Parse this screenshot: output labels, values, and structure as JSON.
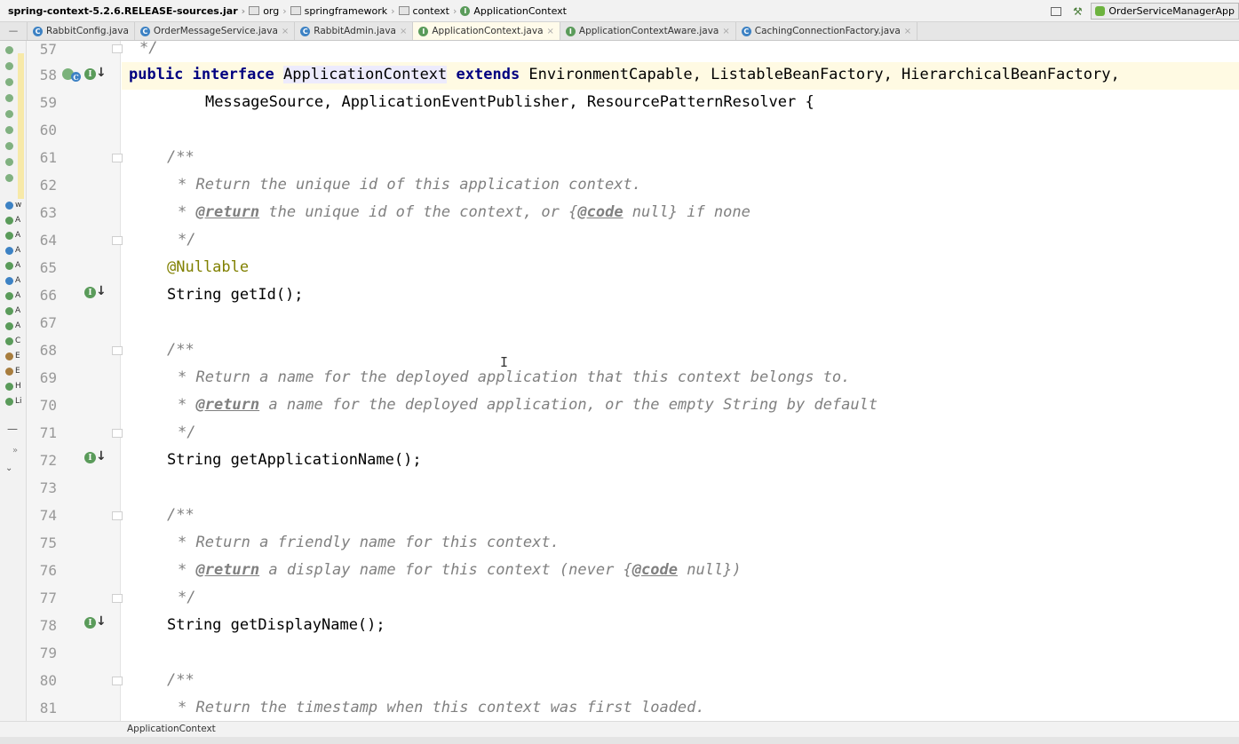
{
  "breadcrumb": {
    "jar": "spring-context-5.2.6.RELEASE-sources.jar",
    "segments": [
      "org",
      "springframework",
      "context"
    ],
    "current": "ApplicationContext"
  },
  "run_config": "OrderServiceManagerApp",
  "tabs": [
    {
      "label": "RabbitConfig.java",
      "type": "class"
    },
    {
      "label": "OrderMessageService.java",
      "type": "class"
    },
    {
      "label": "RabbitAdmin.java",
      "type": "class"
    },
    {
      "label": "ApplicationContext.java",
      "type": "interface",
      "active": true
    },
    {
      "label": "ApplicationContextAware.java",
      "type": "interface"
    },
    {
      "label": "CachingConnectionFactory.java",
      "type": "class"
    }
  ],
  "structure_items": [
    "w",
    "A",
    "A",
    "A",
    "A",
    "A",
    "A",
    "A",
    "A",
    "C",
    "E",
    "E",
    "H",
    "Li"
  ],
  "line_numbers": [
    "57",
    "58",
    "59",
    "60",
    "61",
    "62",
    "63",
    "64",
    "65",
    "66",
    "67",
    "68",
    "69",
    "70",
    "71",
    "72",
    "73",
    "74",
    "75",
    "76",
    "77",
    "78",
    "79",
    "80",
    "81"
  ],
  "code": {
    "l57": "*/",
    "l58": {
      "public": "public",
      "interface": "interface",
      "name": "ApplicationContext",
      "extends": "extends",
      "rest": " EnvironmentCapable, ListableBeanFactory, HierarchicalBeanFactory,"
    },
    "l59": "MessageSource, ApplicationEventPublisher, ResourcePatternResolver {",
    "l61": "/**",
    "l62": "* Return the unique id of this application context.",
    "l63": {
      "star": "* ",
      "tag": "@return",
      "text": " the unique id of the context, or {",
      "code_tag": "@code",
      "tail": " null} if none"
    },
    "l64": "*/",
    "l65": "@Nullable",
    "l66": "String getId();",
    "l68": "/**",
    "l69": "* Return a name for the deployed application that this context belongs to.",
    "l70": {
      "star": "* ",
      "tag": "@return",
      "text": " a name for the deployed application, or the empty String by default"
    },
    "l71": "*/",
    "l72": "String getApplicationName();",
    "l74": "/**",
    "l75": "* Return a friendly name for this context.",
    "l76": {
      "star": "* ",
      "tag": "@return",
      "text": " a display name for this context (never {",
      "code_tag": "@code",
      "tail": " null})"
    },
    "l77": "*/",
    "l78": "String getDisplayName();",
    "l80": "/**",
    "l81": "* Return the timestamp when this context was first loaded."
  },
  "gutter_icon_letter": "I",
  "class_icon_letter": "C",
  "bottom_breadcrumb": "ApplicationContext",
  "text_cursor": "I",
  "icons": {
    "implemented": "implemented-icon",
    "arrow": "down-arrow-icon"
  },
  "colors": {
    "keyword": "#000080",
    "comment": "#808080",
    "annotation": "#808000",
    "current_line": "#fffae3",
    "active_tab": "#fffbea",
    "icon_green": "#5a9b5a"
  }
}
